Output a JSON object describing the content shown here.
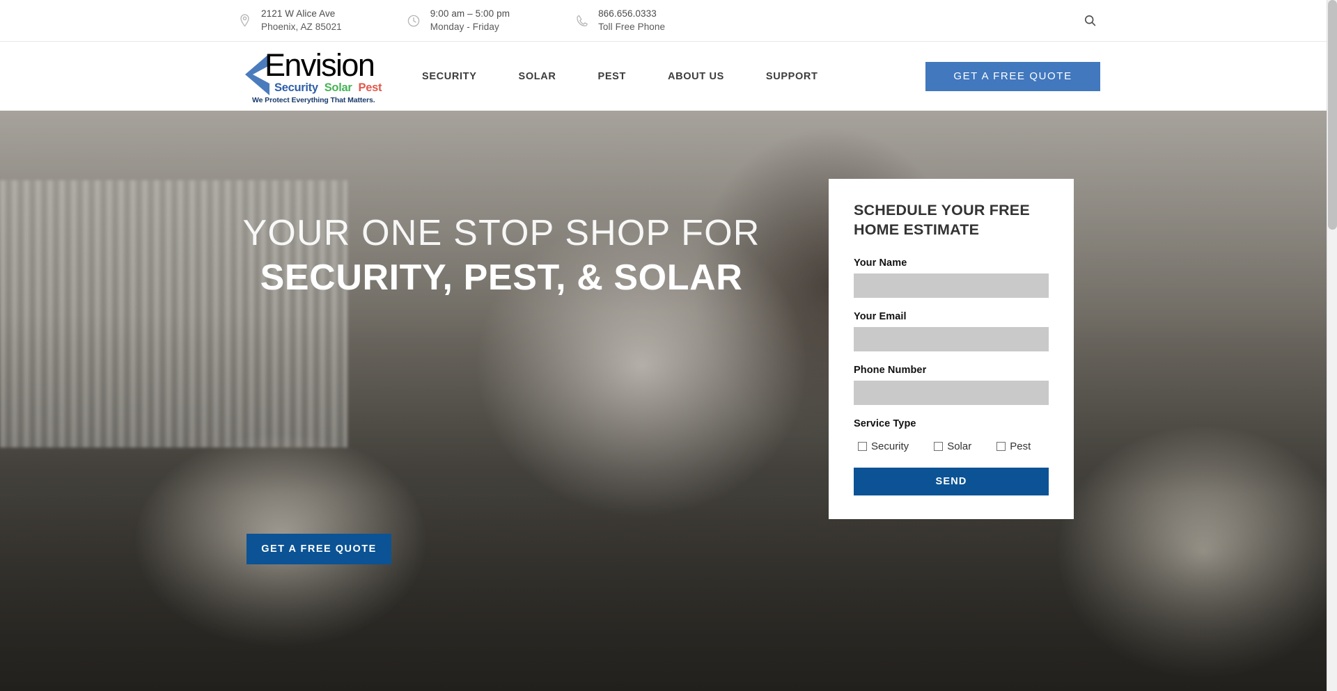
{
  "topbar": {
    "items": [
      {
        "icon": "location-pin-icon",
        "line1": "2121 W Alice Ave",
        "line2": "Phoenix, AZ 85021"
      },
      {
        "icon": "clock-icon",
        "line1": "9:00 am – 5:00 pm",
        "line2": "Monday - Friday"
      },
      {
        "icon": "phone-icon",
        "line1": "866.656.0333",
        "line2": "Toll Free Phone"
      }
    ],
    "search_icon": "search-icon"
  },
  "header": {
    "logo": {
      "word": "Envision",
      "security": "Security",
      "solar": "Solar",
      "pest": "Pest",
      "tagline": "We Protect Everything That Matters.",
      "security_color": "#2f5fa8",
      "solar_color": "#46b356",
      "pest_color": "#e2584a",
      "chevron_color": "#4a7cbd"
    },
    "nav": [
      {
        "label": "SECURITY"
      },
      {
        "label": "SOLAR"
      },
      {
        "label": "PEST"
      },
      {
        "label": "ABOUT US"
      },
      {
        "label": "SUPPORT"
      }
    ],
    "cta_label": "GET A FREE QUOTE",
    "cta_color": "#4178be"
  },
  "hero": {
    "headline_light": "YOUR ONE STOP SHOP FOR",
    "headline_bold": "SECURITY, PEST, & SOLAR",
    "cta_label": "GET A FREE QUOTE",
    "cta_color": "#0b5394"
  },
  "form": {
    "title": "SCHEDULE YOUR FREE HOME ESTIMATE",
    "name_label": "Your Name",
    "name_value": "",
    "name_placeholder": "",
    "email_label": "Your Email",
    "email_value": "",
    "email_placeholder": "",
    "phone_label": "Phone Number",
    "phone_value": "",
    "phone_placeholder": "",
    "service_label": "Service Type",
    "services": [
      {
        "label": "Security",
        "checked": false
      },
      {
        "label": "Solar",
        "checked": false
      },
      {
        "label": "Pest",
        "checked": false
      }
    ],
    "send_label": "SEND",
    "send_color": "#0b5394",
    "input_bg": "#c9c9c9"
  }
}
